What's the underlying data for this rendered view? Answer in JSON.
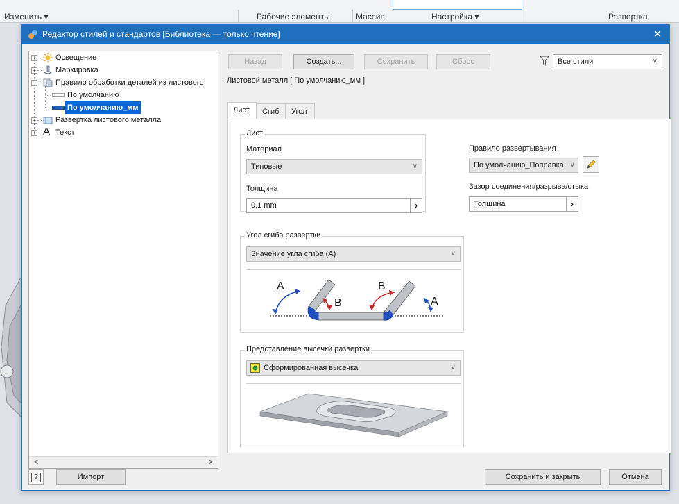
{
  "ribbon": {
    "izmenit": "Изменить ▾",
    "rabochie": "Рабочие элементы",
    "massiv": "Массив",
    "nastroika": "Настройка ▾",
    "razvertka": "Развертка"
  },
  "dialog": {
    "title": "Редактор стилей и стандартов [Библиотека — только чтение]",
    "close": "✕"
  },
  "tree": {
    "items": [
      {
        "label": "Освещение"
      },
      {
        "label": "Маркировка"
      },
      {
        "label": "Правило обработки деталей из листового"
      },
      {
        "label": "По умолчанию"
      },
      {
        "label": "По умолчанию_мм"
      },
      {
        "label": "Развертка листового металла"
      },
      {
        "label": "Текст"
      }
    ],
    "scroll_left": "<",
    "scroll_right": ">"
  },
  "toolbar": {
    "back": "Назад",
    "create": "Создать...",
    "save": "Сохранить",
    "reset": "Сброс",
    "filter_value": "Все стили"
  },
  "style_header": "Листовой металл [ По умолчанию_мм ]",
  "tabs": [
    "Лист",
    "Сгиб",
    "Угол"
  ],
  "sheet": {
    "group_title": "Лист",
    "material_label": "Материал",
    "material_value": "Типовые",
    "thickness_label": "Толщина",
    "thickness_value": "0,1 mm",
    "unfold_rule_label": "Правило развертывания",
    "unfold_rule_value": "По умолчанию_Поправка",
    "gap_label": "Зазор соединения/разрыва/стыка",
    "gap_value": "Толщина"
  },
  "bend_angle": {
    "group_title": "Угол сгиба развертки",
    "value": "Значение угла сгиба (A)",
    "label_a": "A",
    "label_b": "B"
  },
  "punch": {
    "group_title": "Представление высечки развертки",
    "value": "Сформированная высечка"
  },
  "footer": {
    "help": "?",
    "import": "Импорт",
    "save_close": "Сохранить и закрыть",
    "cancel": "Отмена"
  },
  "colors": {
    "title_bar": "#1e6fbd",
    "selection": "#0a64d6",
    "bend_blue": "#1f4fbf",
    "bend_red": "#c42a2a"
  }
}
